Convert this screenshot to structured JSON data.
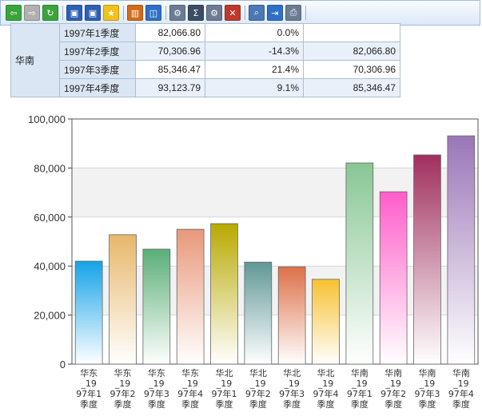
{
  "toolbar": {
    "buttons": [
      {
        "name": "back-icon",
        "color": "#3aa43a",
        "glyph": "⇦"
      },
      {
        "name": "forward-icon",
        "color": "#b0b0b0",
        "glyph": "⇨"
      },
      {
        "name": "refresh-icon",
        "color": "#3aa43a",
        "glyph": "↻"
      },
      {
        "name": "save-icon",
        "color": "#2f5fb3",
        "glyph": "▣"
      },
      {
        "name": "save-as-icon",
        "color": "#2f5fb3",
        "glyph": "▣"
      },
      {
        "name": "favorite-icon",
        "color": "#f1c21b",
        "glyph": "★"
      },
      {
        "name": "chart-icon",
        "color": "#d26b1a",
        "glyph": "▥"
      },
      {
        "name": "window-icon",
        "color": "#2f6fc6",
        "glyph": "◫"
      },
      {
        "name": "settings-icon",
        "color": "#6b7c93",
        "glyph": "⚙"
      },
      {
        "name": "sum-icon",
        "color": "#3b4c66",
        "glyph": "Σ"
      },
      {
        "name": "calc-settings-icon",
        "color": "#6b7c93",
        "glyph": "⚙"
      },
      {
        "name": "delete-column-icon",
        "color": "#c0392b",
        "glyph": "✕"
      },
      {
        "name": "search-icon",
        "color": "#4a78b5",
        "glyph": "⌕"
      },
      {
        "name": "export-icon",
        "color": "#2f6fc6",
        "glyph": "⇥"
      },
      {
        "name": "print-icon",
        "color": "#6b7c93",
        "glyph": "⎙"
      }
    ]
  },
  "table": {
    "region": "华南",
    "rows": [
      {
        "quarter": "1997年1季度",
        "value": "82,066.80",
        "growth": "0.0%",
        "prev": ""
      },
      {
        "quarter": "1997年2季度",
        "value": "70,306.96",
        "growth": "-14.3%",
        "prev": "82,066.80"
      },
      {
        "quarter": "1997年3季度",
        "value": "85,346.47",
        "growth": "21.4%",
        "prev": "70,306.96"
      },
      {
        "quarter": "1997年4季度",
        "value": "93,123.79",
        "growth": "9.1%",
        "prev": "85,346.47"
      }
    ]
  },
  "chart_data": {
    "type": "bar",
    "title": "",
    "xlabel": "",
    "ylabel": "",
    "ylim": [
      0,
      100000
    ],
    "yticks": [
      "0",
      "20,000",
      "40,000",
      "60,000",
      "80,000",
      "100,000"
    ],
    "grid": true,
    "categories": [
      [
        "华东",
        "_19",
        "97年1",
        "季度"
      ],
      [
        "华东",
        "_19",
        "97年2",
        "季度"
      ],
      [
        "华东",
        "_19",
        "97年3",
        "季度"
      ],
      [
        "华东",
        "_19",
        "97年4",
        "季度"
      ],
      [
        "华北",
        "_19",
        "97年1",
        "季度"
      ],
      [
        "华北",
        "_19",
        "97年2",
        "季度"
      ],
      [
        "华北",
        "_19",
        "97年3",
        "季度"
      ],
      [
        "华北",
        "_19",
        "97年4",
        "季度"
      ],
      [
        "华南",
        "_19",
        "97年1",
        "季度"
      ],
      [
        "华南",
        "_19",
        "97年2",
        "季度"
      ],
      [
        "华南",
        "_19",
        "97年3",
        "季度"
      ],
      [
        "华南",
        "_19",
        "97年4",
        "季度"
      ]
    ],
    "values": [
      42000,
      52800,
      46900,
      55000,
      57300,
      41600,
      39700,
      34600,
      82066.8,
      70306.96,
      85346.47,
      93123.79
    ],
    "colors": [
      "#14a3e8",
      "#e7b76a",
      "#5aae77",
      "#e8987a",
      "#b8a900",
      "#5f9897",
      "#dd7047",
      "#f7c12f",
      "#88c694",
      "#ff5dc9",
      "#a02f5d",
      "#9b75b8"
    ]
  }
}
